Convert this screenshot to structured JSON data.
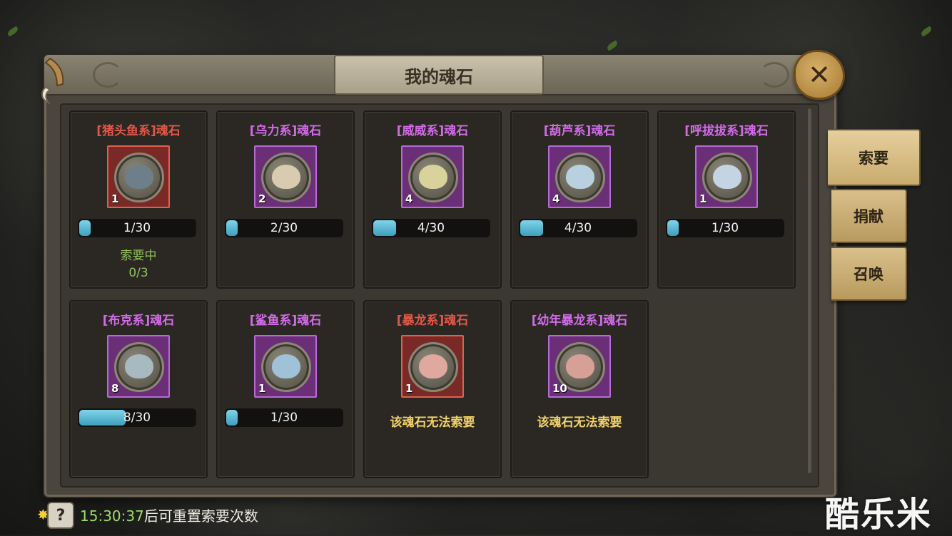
{
  "window": {
    "title": "我的魂石"
  },
  "tabs": [
    {
      "label": "索要",
      "active": true
    },
    {
      "label": "捐献",
      "active": false
    },
    {
      "label": "召唤",
      "active": false
    }
  ],
  "cards": [
    {
      "name": "[猪头鱼系]魂石",
      "rarity": "red",
      "count": "1",
      "progress": "1/30",
      "fraction": 0.033,
      "status_line1": "索要中",
      "status_line2": "0/3",
      "note": ""
    },
    {
      "name": "[乌力系]魂石",
      "rarity": "purple",
      "count": "2",
      "progress": "2/30",
      "fraction": 0.067,
      "status_line1": "",
      "status_line2": "",
      "note": ""
    },
    {
      "name": "[威威系]魂石",
      "rarity": "purple",
      "count": "4",
      "progress": "4/30",
      "fraction": 0.133,
      "status_line1": "",
      "status_line2": "",
      "note": ""
    },
    {
      "name": "[葫芦系]魂石",
      "rarity": "purple",
      "count": "4",
      "progress": "4/30",
      "fraction": 0.133,
      "status_line1": "",
      "status_line2": "",
      "note": ""
    },
    {
      "name": "[呼拔拔系]魂石",
      "rarity": "purple",
      "count": "1",
      "progress": "1/30",
      "fraction": 0.033,
      "status_line1": "",
      "status_line2": "",
      "note": ""
    },
    {
      "name": "[布克系]魂石",
      "rarity": "purple",
      "count": "8",
      "progress": "8/30",
      "fraction": 0.267,
      "status_line1": "",
      "status_line2": "",
      "note": ""
    },
    {
      "name": "[鲨鱼系]魂石",
      "rarity": "purple",
      "count": "1",
      "progress": "1/30",
      "fraction": 0.033,
      "status_line1": "",
      "status_line2": "",
      "note": ""
    },
    {
      "name": "[暴龙系]魂石",
      "rarity": "red",
      "count": "1",
      "progress": "",
      "fraction": null,
      "status_line1": "",
      "status_line2": "",
      "note": "该魂石无法索要"
    },
    {
      "name": "[幼年暴龙系]魂石",
      "rarity": "purple",
      "count": "10",
      "progress": "",
      "fraction": null,
      "status_line1": "",
      "status_line2": "",
      "note": "该魂石无法索要"
    }
  ],
  "footer": {
    "time": "15:30:37",
    "text": "后可重置索要次数"
  },
  "watermark": "酷乐米",
  "colors": {
    "red_title": "#e0584a",
    "purple_title": "#d26be8",
    "status_green": "#8fc25b",
    "note_yellow": "#f2d36b",
    "bar_fill": "#3d9fbd"
  },
  "icons": {
    "close": "close-x-icon",
    "help": "question-icon",
    "star": "star-icon"
  }
}
